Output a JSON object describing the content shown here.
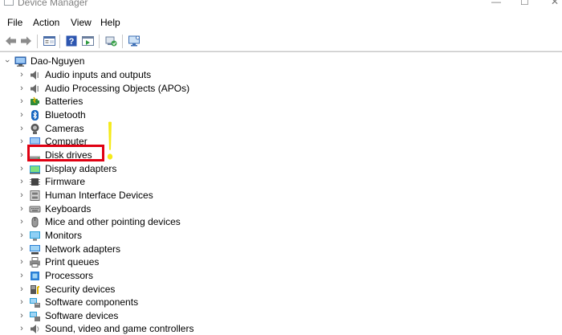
{
  "window": {
    "title": "Device Manager",
    "minimize_glyph": "—",
    "maximize_glyph": "☐",
    "close_glyph": "✕"
  },
  "menu": [
    "File",
    "Action",
    "View",
    "Help"
  ],
  "toolbar": {
    "buttons": [
      "back-arrow-icon",
      "forward-arrow-icon",
      "properties-icon",
      "help-icon",
      "show-hidden-icon",
      "update-driver-icon",
      "scan-hardware-icon"
    ]
  },
  "tree": {
    "root": "Dao-Nguyen",
    "expand_glyph": "›",
    "collapse_glyph": "⌄",
    "items": [
      {
        "label": "Audio inputs and outputs",
        "icon": "speaker-icon"
      },
      {
        "label": "Audio Processing Objects (APOs)",
        "icon": "speaker-icon"
      },
      {
        "label": "Batteries",
        "icon": "battery-icon"
      },
      {
        "label": "Bluetooth",
        "icon": "bluetooth-icon"
      },
      {
        "label": "Cameras",
        "icon": "camera-icon"
      },
      {
        "label": "Computer",
        "icon": "computer-icon"
      },
      {
        "label": "Disk drives",
        "icon": "disk-drive-icon"
      },
      {
        "label": "Display adapters",
        "icon": "display-adapter-icon"
      },
      {
        "label": "Firmware",
        "icon": "firmware-icon"
      },
      {
        "label": "Human Interface Devices",
        "icon": "hid-icon"
      },
      {
        "label": "Keyboards",
        "icon": "keyboard-icon"
      },
      {
        "label": "Mice and other pointing devices",
        "icon": "mouse-icon"
      },
      {
        "label": "Monitors",
        "icon": "monitor-icon"
      },
      {
        "label": "Network adapters",
        "icon": "network-adapter-icon"
      },
      {
        "label": "Print queues",
        "icon": "printer-icon"
      },
      {
        "label": "Processors",
        "icon": "processor-icon"
      },
      {
        "label": "Security devices",
        "icon": "security-device-icon"
      },
      {
        "label": "Software components",
        "icon": "software-component-icon"
      },
      {
        "label": "Software devices",
        "icon": "software-device-icon"
      },
      {
        "label": "Sound, video and game controllers",
        "icon": "sound-controller-icon"
      }
    ]
  },
  "annotation": {
    "highlighted_item": "Disk drives",
    "box_color": "#e00012",
    "exclamation_color": "#f5ea1a"
  }
}
